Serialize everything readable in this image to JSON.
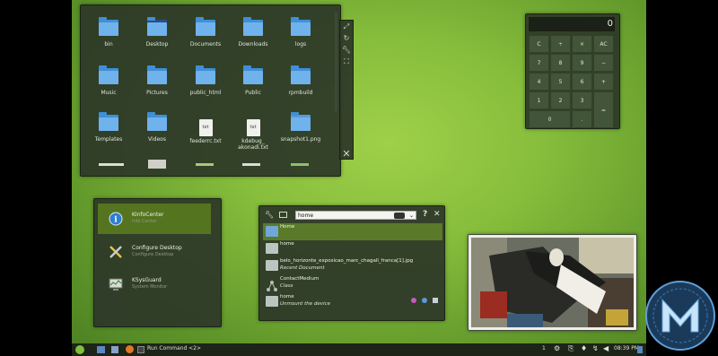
{
  "folder_view": {
    "items": [
      {
        "label": "bin",
        "kind": "folder"
      },
      {
        "label": "Desktop",
        "kind": "desktop"
      },
      {
        "label": "Documents",
        "kind": "folder"
      },
      {
        "label": "Downloads",
        "kind": "folder"
      },
      {
        "label": "logs",
        "kind": "folder"
      },
      {
        "label": "Music",
        "kind": "folder"
      },
      {
        "label": "Pictures",
        "kind": "folder"
      },
      {
        "label": "public_html",
        "kind": "folder"
      },
      {
        "label": "Public",
        "kind": "folder"
      },
      {
        "label": "rpmbuild",
        "kind": "folder"
      },
      {
        "label": "Templates",
        "kind": "folder"
      },
      {
        "label": "Videos",
        "kind": "folder"
      },
      {
        "label": "feederrc.txt",
        "kind": "txt"
      },
      {
        "label": "kdebug_\nakonadi.txt",
        "kind": "txt"
      },
      {
        "label": "snapshot1.png",
        "kind": "image"
      }
    ],
    "file_badge": "txt",
    "side_tools": [
      "resize-icon",
      "rotate-icon",
      "wrench-icon",
      "expand-icon"
    ],
    "close_glyph": "✕"
  },
  "calculator": {
    "display": "0",
    "buttons": [
      "C",
      "÷",
      "×",
      "AC",
      "7",
      "8",
      "9",
      "−",
      "4",
      "5",
      "6",
      "+",
      "1",
      "2",
      "3",
      "=",
      "0",
      "."
    ]
  },
  "kickoff": {
    "items": [
      {
        "title": "KInfoCenter",
        "subtitle": "Info Center",
        "selected": true
      },
      {
        "title": "Configure Desktop",
        "subtitle": "Configure Desktop",
        "selected": false
      },
      {
        "title": "KSysGuard",
        "subtitle": "System Monitor",
        "selected": false
      }
    ]
  },
  "krunner": {
    "query": "home",
    "help_glyph": "?",
    "close_glyph": "✕",
    "results": [
      {
        "title": "Home",
        "subtitle": "",
        "selected": true
      },
      {
        "title": "home",
        "subtitle": "",
        "selected": false
      },
      {
        "title": "belo_horizonte_exposicao_marc_chagall_franca[1].jpg",
        "subtitle": "Recent Document",
        "selected": false
      },
      {
        "title": "ContactMedium",
        "subtitle": "Class",
        "selected": false
      },
      {
        "title": "home",
        "subtitle": "Unmount the device",
        "selected": false
      }
    ]
  },
  "taskbar": {
    "task_label": "Run Command <2>",
    "pager": "1",
    "clock": "08:39 PM"
  },
  "colors": {
    "accent": "#5a7a2a",
    "wallpaper": "#86bd3b",
    "panel": "#2c3628"
  }
}
